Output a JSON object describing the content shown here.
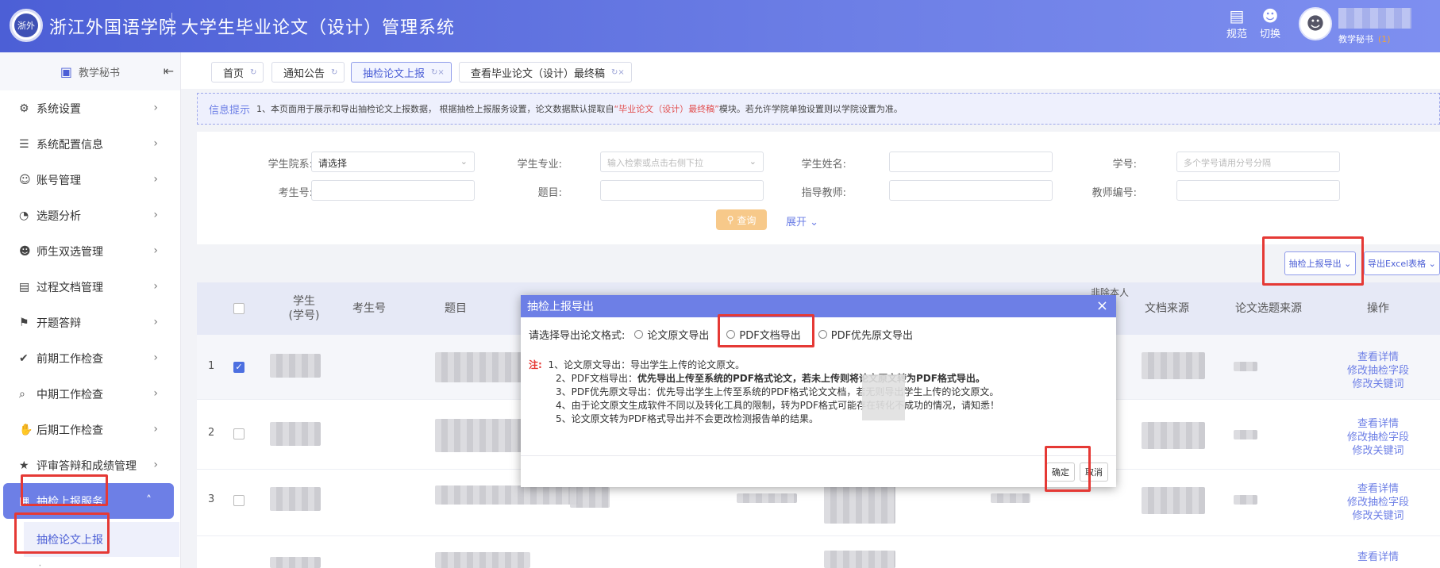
{
  "header": {
    "logo_text": "浙外",
    "school_name": "浙江外国语学院",
    "system_name": "大学生毕业论文（设计）管理系统",
    "btn_rule": "规范",
    "btn_switch": "切换",
    "user_role": "教学秘书",
    "user_role_count": "(1)"
  },
  "sidebar": {
    "title": "教学秘书",
    "items": [
      {
        "label": "系统设置",
        "icon": "gear-icon"
      },
      {
        "label": "系统配置信息",
        "icon": "sliders-icon"
      },
      {
        "label": "账号管理",
        "icon": "account-icon"
      },
      {
        "label": "选题分析",
        "icon": "analysis-icon"
      },
      {
        "label": "师生双选管理",
        "icon": "users-icon"
      },
      {
        "label": "过程文档管理",
        "icon": "document-icon"
      },
      {
        "label": "开题答辩",
        "icon": "defense-icon"
      },
      {
        "label": "前期工作检查",
        "icon": "check-icon"
      },
      {
        "label": "中期工作检查",
        "icon": "search-check-icon"
      },
      {
        "label": "后期工作检查",
        "icon": "hand-icon"
      },
      {
        "label": "评审答辩和成绩管理",
        "icon": "grade-icon"
      },
      {
        "label": "抽检上报服务",
        "icon": "report-icon"
      }
    ],
    "sub_item": "抽检论文上报"
  },
  "tabs": [
    {
      "label": "首页"
    },
    {
      "label": "通知公告"
    },
    {
      "label": "抽检论文上报"
    },
    {
      "label": "查看毕业论文（设计）最终稿"
    }
  ],
  "info": {
    "label": "信息提示",
    "text_a": "1、本页面用于展示和导出抽检论文上报数据， 根据抽检上报服务设置，论文数据默认提取自",
    "highlight": "“毕业论文（设计）最终稿”",
    "text_b": "模块。若允许学院单独设置则以学院设置为准。"
  },
  "search": {
    "college_label": "学生院系:",
    "college_value": "请选择",
    "major_label": "学生专业:",
    "major_placeholder": "输入检索或点击右侧下拉",
    "name_label": "学生姓名:",
    "stuno_label": "学号:",
    "stuno_placeholder": "多个学号请用分号分隔",
    "examno_label": "考生号:",
    "title_label": "题目:",
    "advisor_label": "指导教师:",
    "teacherno_label": "教师编号:",
    "query_btn": "查询",
    "expand": "展开"
  },
  "export": {
    "report_export": "抽检上报导出",
    "excel_export": "导出Excel表格"
  },
  "table": {
    "headers": {
      "student": "学生\n(学号)",
      "examno": "考生号",
      "title": "题目",
      "owner": "非除本人",
      "source": "文档来源",
      "topic_source": "论文选题来源",
      "action": "操作"
    },
    "rows": [
      {
        "index": "1",
        "checked": true
      },
      {
        "index": "2",
        "checked": false
      },
      {
        "index": "3",
        "checked": false
      },
      {
        "index": "",
        "checked": false
      }
    ],
    "actions": [
      "查看详情",
      "修改抽检字段",
      "修改关键词"
    ]
  },
  "modal": {
    "title": "抽检上报导出",
    "format_label": "请选择导出论文格式:",
    "opt_original": "论文原文导出",
    "opt_pdf": "PDF文档导出",
    "opt_pdf_first": "PDF优先原文导出",
    "note_label": "注:",
    "note1": "1、论文原文导出：导出学生上传的论文原文。",
    "note2_a": "2、PDF文档导出：",
    "note2_b": "优先导出上传至系统的PDF格式论文，若未上传则将论文原文转为PDF格式导出。",
    "note3": "3、PDF优先原文导出：优先导出学生上传至系统的PDF格式论文文档，若无则导出学生上传的论文原文。",
    "note4": "4、由于论文原文生成软件不同以及转化工具的限制，转为PDF格式可能存在转化不成功的情况，请知悉！",
    "note5": "5、论文原文转为PDF格式导出并不会更改检测报告单的结果。",
    "confirm": "确定",
    "cancel": "取消"
  }
}
